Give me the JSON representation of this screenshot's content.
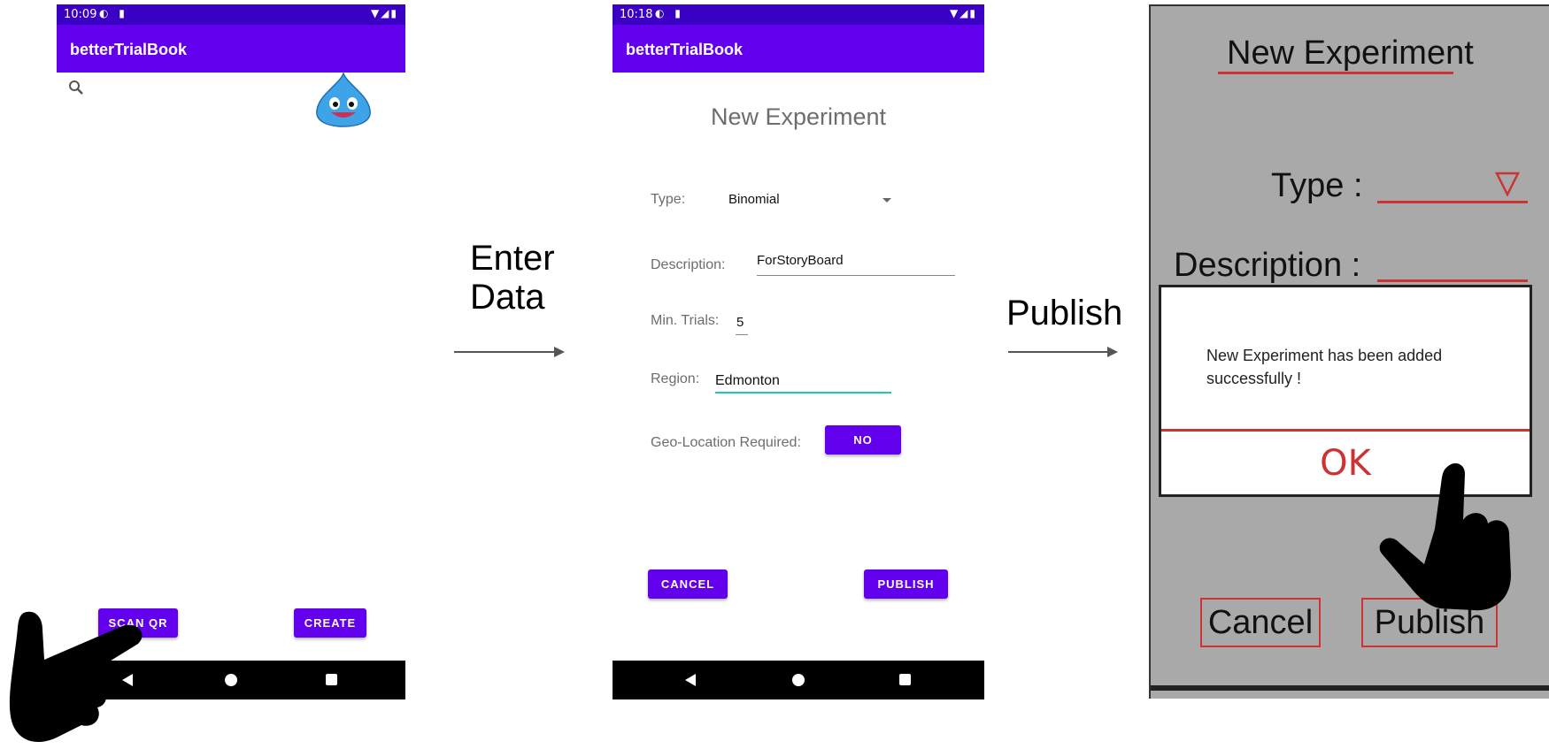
{
  "screen1": {
    "status_time": "10:09",
    "app_title": "betterTrialBook",
    "buttons": {
      "scan_qr": "SCAN QR",
      "create": "CREATE"
    }
  },
  "transition1": {
    "caption_line1": "Enter",
    "caption_line2": "Data"
  },
  "screen2": {
    "status_time": "10:18",
    "app_title": "betterTrialBook",
    "heading": "New Experiment",
    "fields": {
      "type_label": "Type:",
      "type_value": "Binomial",
      "description_label": "Description:",
      "description_value": "ForStoryBoard",
      "min_trials_label": "Min. Trials:",
      "min_trials_value": "5",
      "region_label": "Region:",
      "region_value": "Edmonton",
      "geo_label": "Geo-Location Required:",
      "geo_value": "NO"
    },
    "buttons": {
      "cancel": "CANCEL",
      "publish": "PUBLISH"
    }
  },
  "transition2": {
    "caption": "Publish"
  },
  "sketch": {
    "heading": "New Experiment",
    "type_label": "Type :",
    "description_label": "Description :",
    "dialog_message": "New Experiment has been added successfully !",
    "ok_label": "OK",
    "cancel_label": "Cancel",
    "publish_label": "Publish"
  },
  "colors": {
    "primary": "#6200ee",
    "status_bar": "#3a00c4",
    "accent_underline": "#1ec8b4",
    "sketch_red": "#cc3333",
    "sketch_background": "#a9a9a9"
  }
}
